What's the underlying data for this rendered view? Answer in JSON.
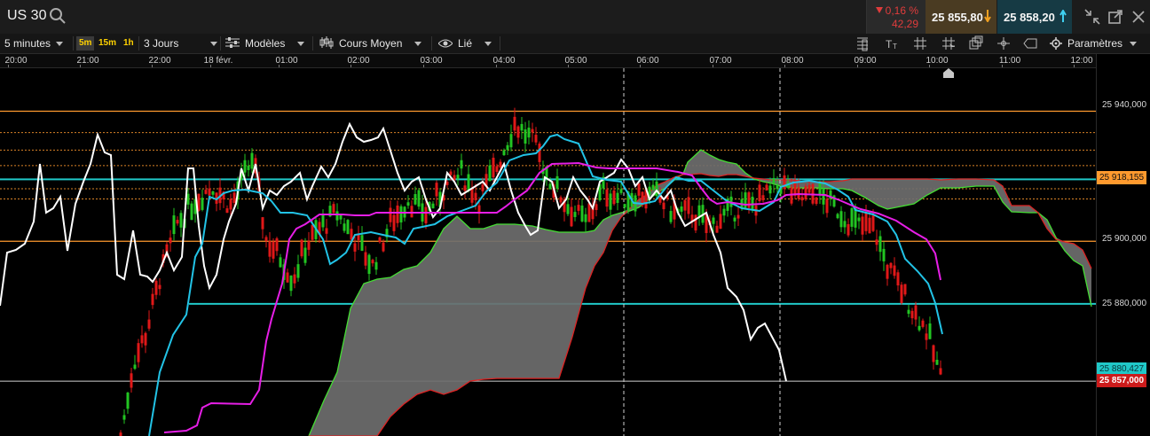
{
  "header": {
    "symbol": "US 30",
    "change_pct": "0,16 %",
    "change_pts": "42,29",
    "bid": "25 855,80",
    "ask": "25 858,20",
    "icons": [
      "search-icon",
      "trend-down-icon",
      "arrow-down-icon",
      "arrow-up-icon",
      "collapse-icon",
      "popout-icon",
      "close-icon"
    ]
  },
  "toolbar": {
    "interval": "5 minutes",
    "tf_5m": "5m",
    "tf_15m": "15m",
    "tf_1h": "1h",
    "range": "3 Jours",
    "templates": "Modèles",
    "chart_type": "Cours Moyen",
    "linked": "Lié",
    "settings": "Paramètres"
  },
  "time_axis": [
    "20:00",
    "21:00",
    "22:00",
    "18 févr.",
    "01:00",
    "02:00",
    "03:00",
    "04:00",
    "05:00",
    "06:00",
    "07:00",
    "08:00",
    "09:00",
    "10:00",
    "11:00",
    "12:00"
  ],
  "price_axis": [
    "25 940,000",
    "25 900,000",
    "25 880,000"
  ],
  "tags": {
    "orange": "25 918,155",
    "teal": "25 880,427",
    "current": "25 857,000"
  },
  "colors": {
    "up": "#22c522",
    "down": "#e01818",
    "close_line": "#ffffff",
    "tenkan": "#22c3e6",
    "kijun": "#e61ee6",
    "span_a": "#44dd33",
    "span_b": "#dd2222",
    "cloud": "#6e6e6e",
    "level_orange": "#ff9a2e",
    "level_teal": "#20c8c8"
  },
  "chart_data": {
    "type": "line",
    "instrument": "US 30",
    "interval": "5 minutes",
    "range": "3 Jours",
    "x_labels": [
      "20:00",
      "21:00",
      "22:00",
      "18 févr.",
      "01:00",
      "02:00",
      "03:00",
      "04:00",
      "05:00",
      "06:00",
      "07:00",
      "08:00",
      "09:00",
      "10:00",
      "11:00",
      "12:00"
    ],
    "y_labels": [
      25940,
      25900,
      25880
    ],
    "ylim": [
      25848,
      25950
    ],
    "levels": [
      25938.8,
      25918.155,
      25899.4,
      25880.427
    ],
    "dotted_levels": [
      25932.3,
      25927.0,
      25922.3,
      25915.3,
      25912.2
    ],
    "current_price": 25857.0,
    "grid": false
  }
}
